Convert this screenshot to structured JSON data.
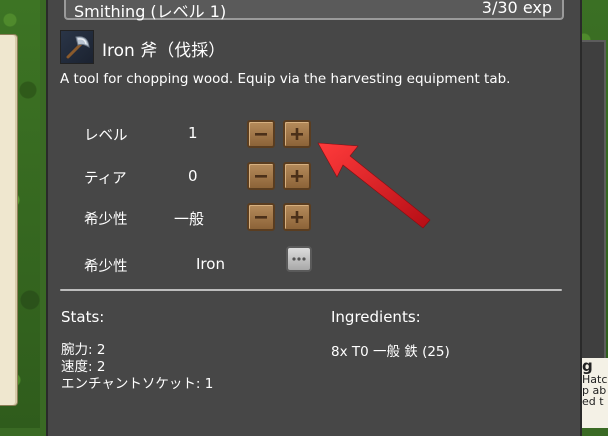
{
  "skill_bar": {
    "name": "Smithing (レベル 1)",
    "xp": "3/30 exp"
  },
  "item": {
    "icon": "axe-icon",
    "title": "Iron 斧（伐採）",
    "description": "A tool for chopping wood. Equip via the harvesting equipment tab."
  },
  "rows": {
    "level": {
      "label": "レベル",
      "value": "1"
    },
    "tier": {
      "label": "ティア",
      "value": "0"
    },
    "rarity": {
      "label": "希少性",
      "value": "一般"
    },
    "material": {
      "label": "希少性",
      "value": "Iron"
    }
  },
  "buttons": {
    "minus": "−",
    "plus": "+"
  },
  "stats": {
    "title": "Stats:",
    "lines": [
      "腕力: 2",
      "速度: 2",
      "エンチャントソケット: 1"
    ]
  },
  "ingredients": {
    "title": "Ingredients:",
    "lines": [
      "8x T0 一般 鉄 (25)"
    ]
  },
  "side_tooltip": {
    "title": "g",
    "lines": [
      "Hatc",
      "p ab",
      "ed t"
    ]
  },
  "colors": {
    "arrow": "#d8121b",
    "panel": "#474747",
    "button": "#a47748"
  }
}
